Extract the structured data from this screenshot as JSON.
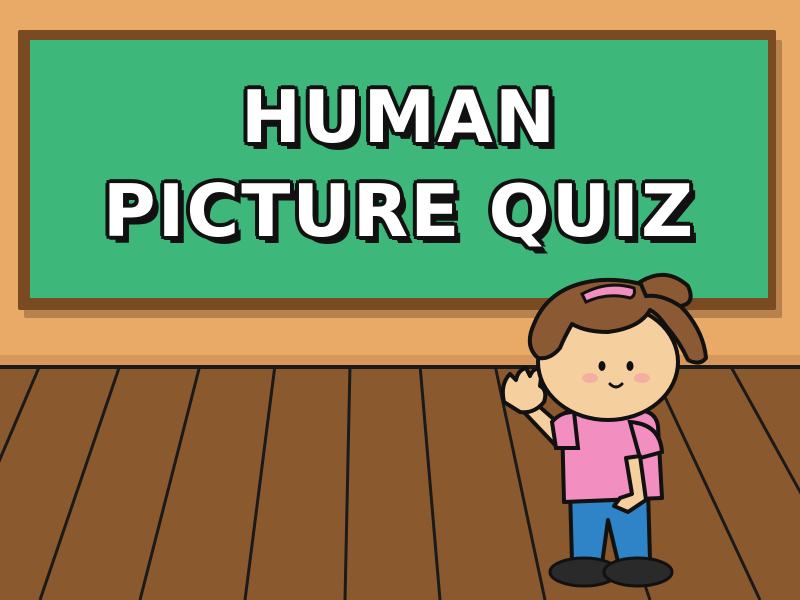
{
  "title": {
    "line1": "HUMAN",
    "line2": "PICTURE QUIZ"
  },
  "colors": {
    "wall": "#E9AA68",
    "board_frame": "#7A4A22",
    "board_surface": "#3DB87A",
    "floor": "#8A5A2E",
    "floor_lines": "#1A1A1A",
    "shirt": "#F28EC0",
    "pants": "#2E84C6",
    "hair": "#8B5A34",
    "skin": "#F6CF9E"
  },
  "illustration": {
    "character": "girl-waving",
    "floor_type": "wood-planks"
  }
}
